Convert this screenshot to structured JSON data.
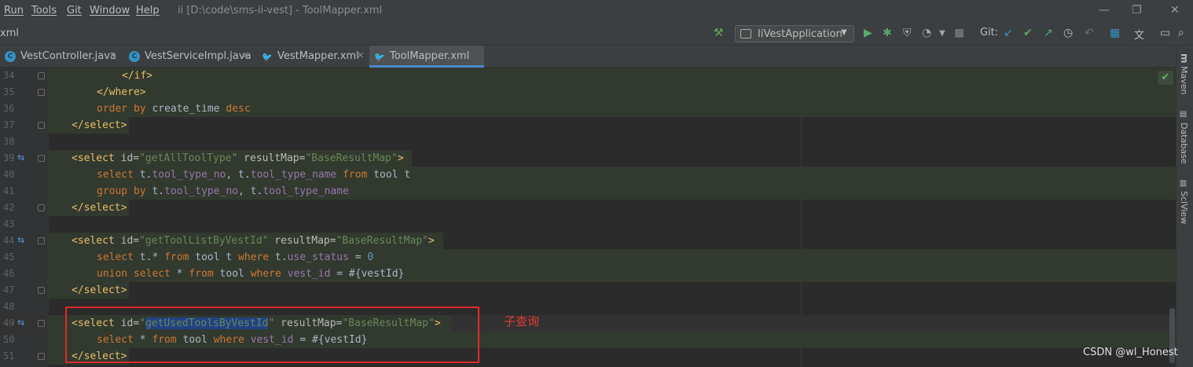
{
  "menu": [
    "Run",
    "Tools",
    "Git",
    "Window",
    "Help"
  ],
  "window_title": "ii [D:\\code\\sms-ii-vest] - ToolMapper.xml",
  "window_controls": {
    "minimize": "—",
    "restore": "❐",
    "close": "✕"
  },
  "breadcrumb": "xml",
  "run_config": "IiVestApplication",
  "git_label": "Git:",
  "tabs": [
    {
      "label": "VestController.java",
      "icon": "java-class-icon"
    },
    {
      "label": "VestServiceImpl.java",
      "icon": "java-class-icon"
    },
    {
      "label": "VestMapper.xml",
      "icon": "mybatis-xml-icon"
    },
    {
      "label": "ToolMapper.xml",
      "icon": "mybatis-xml-icon",
      "active": true
    }
  ],
  "side_tools": [
    "Maven",
    "Database",
    "SciView"
  ],
  "line_numbers": [
    "34",
    "35",
    "36",
    "37",
    "38",
    "39",
    "40",
    "41",
    "42",
    "43",
    "44",
    "45",
    "46",
    "47",
    "48",
    "49",
    "50",
    "51"
  ],
  "code": {
    "l34": {
      "tag": "</if>"
    },
    "l35": {
      "tag": "</where>"
    },
    "l36": {
      "kw1": "order by",
      "txt": " create_time ",
      "kw2": "desc"
    },
    "l37": {
      "tag": "</select>"
    },
    "l39": {
      "open": "<select",
      "a1": " id=",
      "v1": "\"getAllToolType\"",
      "a2": " resultMap=",
      "v2": "\"BaseResultMap\"",
      "close": ">"
    },
    "l40": {
      "k1": "select",
      "p1": " t.",
      "i1": "tool_type_no",
      "p2": ", t.",
      "i2": "tool_type_name",
      "k2": " from",
      "p3": " tool t"
    },
    "l41": {
      "k1": "group by",
      "p1": " t.",
      "i1": "tool_type_no",
      "p2": ", t.",
      "i2": "tool_type_name"
    },
    "l42": {
      "tag": "</select>"
    },
    "l44": {
      "open": "<select",
      "a1": " id=",
      "v1": "\"getToolListByVestId\"",
      "a2": " resultMap=",
      "v2": "\"BaseResultMap\"",
      "close": ">"
    },
    "l45": {
      "k1": "select",
      "p1": " t.* ",
      "k2": "from",
      "p2": " tool t ",
      "k3": "where",
      "p3": " t.",
      "i1": "use_status",
      "p4": " = ",
      "n1": "0"
    },
    "l46": {
      "k1": "union select",
      "p1": " * ",
      "k2": "from",
      "p2": " tool ",
      "k3": "where",
      "i1": " vest_id",
      "p3": " = #{vestId}"
    },
    "l47": {
      "tag": "</select>"
    },
    "l49": {
      "open": "<select",
      "a1": " id=",
      "q1": "\"",
      "sel": "getUsedToolsByVestId",
      "q2": "\"",
      "a2": " resultMap=",
      "v2": "\"BaseResultMap\"",
      "close": ">"
    },
    "l50": {
      "k1": "select",
      "p1": " * ",
      "k2": "from",
      "p2": " tool ",
      "k3": "where",
      "i1": " vest_id",
      "p3": " = #{vestId}"
    },
    "l51": {
      "tag": "</select>"
    }
  },
  "annotation": "子查询",
  "watermark": "CSDN @wl_Honest",
  "colors": {
    "annotation_red": "#e02a2a",
    "keyword": "#cc7832",
    "tag": "#e8bf6a",
    "string": "#6a8759",
    "field": "#9876aa"
  }
}
